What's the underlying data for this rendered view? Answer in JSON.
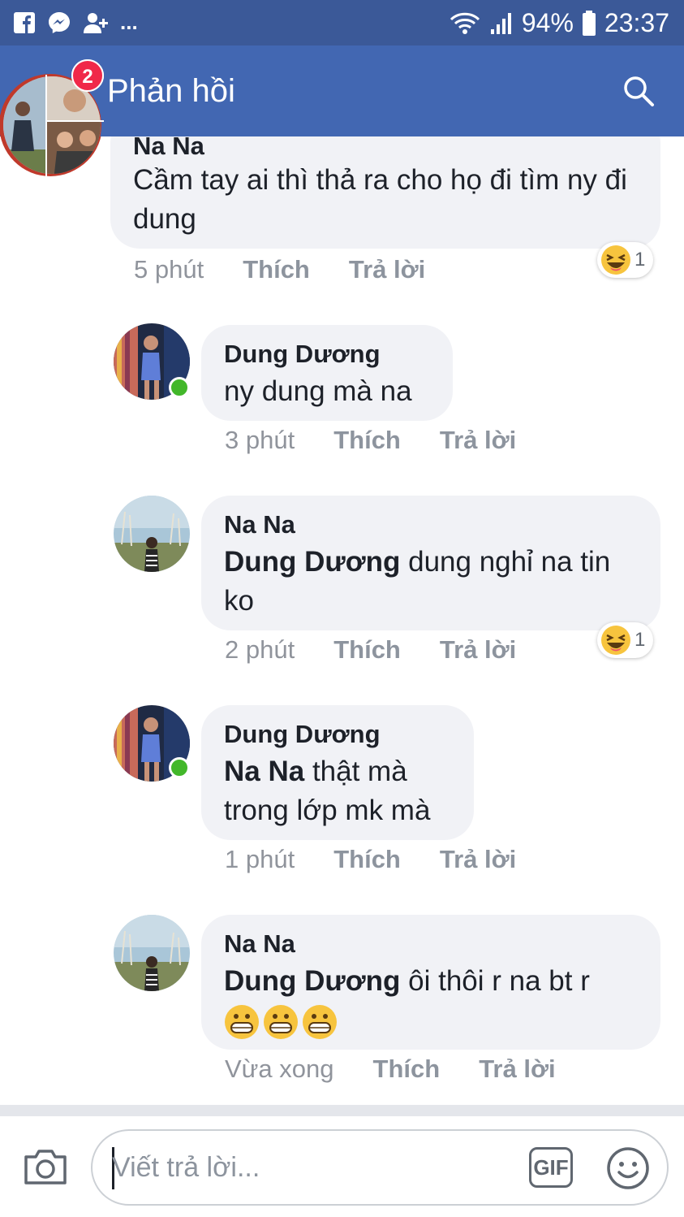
{
  "status_bar": {
    "battery": "94%",
    "time": "23:37",
    "more": "..."
  },
  "header": {
    "title": "Phản hồi",
    "chat_badge": "2"
  },
  "comments": [
    {
      "author": "Na Na",
      "mention": "",
      "text": "Cầm tay ai thì thả ra cho họ đi tìm ny đi dung",
      "time": "5 phút",
      "like": "Thích",
      "reply": "Trả lời",
      "reaction": "1"
    },
    {
      "author": "Dung Dương",
      "mention": "",
      "text": "ny dung mà na",
      "time": "3 phút",
      "like": "Thích",
      "reply": "Trả lời"
    },
    {
      "author": "Na Na",
      "mention": "Dung Dương",
      "text": " dung nghỉ na tin ko",
      "time": "2 phút",
      "like": "Thích",
      "reply": "Trả lời",
      "reaction": "1"
    },
    {
      "author": "Dung Dương",
      "mention": "Na Na",
      "text": " thật mà trong lớp mk mà",
      "time": "1 phút",
      "like": "Thích",
      "reply": "Trả lời"
    },
    {
      "author": "Na Na",
      "mention": "Dung Dương",
      "text": " ôi thôi r na bt r",
      "time": "Vừa xong",
      "like": "Thích",
      "reply": "Trả lời"
    }
  ],
  "composer": {
    "placeholder": "Viết trả lời...",
    "gif_label": "GIF"
  },
  "colors": {
    "status_bar": "#3b5998",
    "header": "#4267b2",
    "bubble": "#f1f2f6",
    "online": "#42b72a",
    "badge": "#f02849"
  }
}
